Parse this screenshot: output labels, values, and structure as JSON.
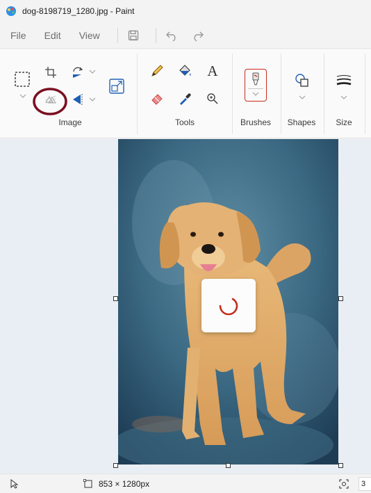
{
  "window": {
    "title": "dog-8198719_1280.jpg - Paint"
  },
  "menu": {
    "file": "File",
    "edit": "Edit",
    "view": "View"
  },
  "ribbon": {
    "groups": {
      "image": "Image",
      "tools": "Tools",
      "brushes": "Brushes",
      "shapes": "Shapes",
      "size": "Size"
    },
    "icons": {
      "select": "select-icon",
      "crop": "crop-icon",
      "rotate": "rotate-icon",
      "remove_background": "remove-background-icon",
      "flip": "flip-icon",
      "resize": "resize-icon",
      "pencil": "pencil-icon",
      "fill": "fill-icon",
      "text": "text-icon",
      "eraser": "eraser-icon",
      "color_picker": "color-picker-icon",
      "magnifier": "magnifier-icon",
      "brushes": "brush-icon",
      "shapes": "shapes-icon",
      "size": "size-icon"
    },
    "text_tool_glyph": "A"
  },
  "status": {
    "dimensions": "853 × 1280px",
    "partial_right": "3"
  },
  "colors": {
    "accent_red": "#c42b1c",
    "annotation_circle": "#7a1020",
    "icon_blue": "#1f5fb5"
  }
}
